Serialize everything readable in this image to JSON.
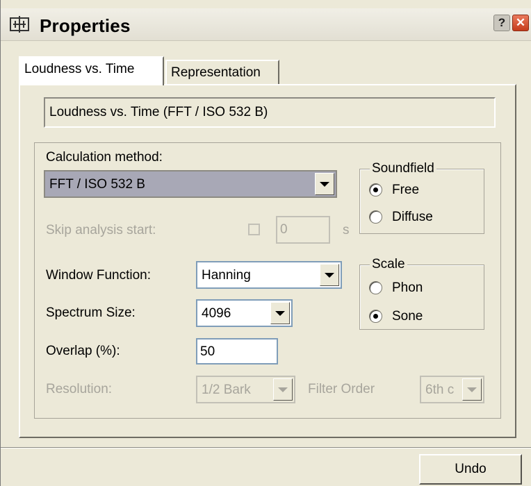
{
  "window": {
    "title": "Properties"
  },
  "title_buttons": {
    "help": "?",
    "close": "✕"
  },
  "tabs": [
    {
      "label": "Loudness vs. Time",
      "active": true
    },
    {
      "label": "Representation",
      "active": false
    }
  ],
  "description": "Loudness vs. Time (FFT / ISO 532 B)",
  "calculation": {
    "label": "Calculation method:",
    "value": "FFT / ISO 532 B"
  },
  "soundfield": {
    "legend": "Soundfield",
    "options": [
      {
        "label": "Free",
        "selected": true
      },
      {
        "label": "Diffuse",
        "selected": false
      }
    ]
  },
  "skip_analysis": {
    "label": "Skip analysis start:",
    "value": "0",
    "unit": "s",
    "checked": false
  },
  "window_function": {
    "label": "Window Function:",
    "value": "Hanning"
  },
  "scale": {
    "legend": "Scale",
    "options": [
      {
        "label": "Phon",
        "selected": false
      },
      {
        "label": "Sone",
        "selected": true
      }
    ]
  },
  "spectrum_size": {
    "label": "Spectrum Size:",
    "value": "4096"
  },
  "overlap": {
    "label": "Overlap (%):",
    "value": "50"
  },
  "resolution": {
    "label": "Resolution:",
    "value": "1/2 Bark"
  },
  "filter_order": {
    "label": "Filter Order",
    "value": "6th c"
  },
  "buttons": {
    "undo": "Undo"
  }
}
